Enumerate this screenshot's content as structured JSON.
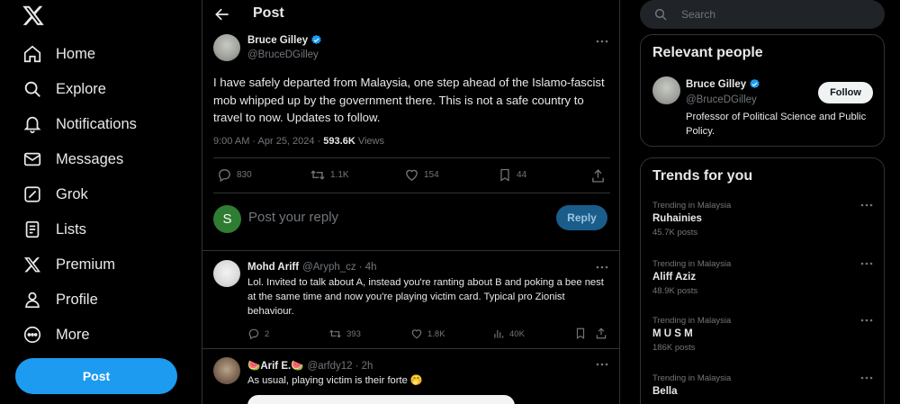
{
  "nav": {
    "items": [
      {
        "label": "Home",
        "icon": "home-icon"
      },
      {
        "label": "Explore",
        "icon": "search-icon"
      },
      {
        "label": "Notifications",
        "icon": "bell-icon"
      },
      {
        "label": "Messages",
        "icon": "envelope-icon"
      },
      {
        "label": "Grok",
        "icon": "grok-icon"
      },
      {
        "label": "Lists",
        "icon": "list-icon"
      },
      {
        "label": "Premium",
        "icon": "x-logo-icon"
      },
      {
        "label": "Profile",
        "icon": "person-icon"
      },
      {
        "label": "More",
        "icon": "more-circle-icon"
      }
    ],
    "post_label": "Post"
  },
  "header": {
    "title": "Post"
  },
  "tweet": {
    "name": "Bruce Gilley",
    "handle": "@BruceDGilley",
    "text": "I have safely departed from Malaysia, one step ahead of the Islamo-fascist mob whipped up by the government there. This is not a safe country to travel to now. Updates to follow.",
    "time": "9:00 AM · Apr 25, 2024 · ",
    "views_count": "593.6K",
    "views_label": " Views",
    "replies": "830",
    "reposts": "1.1K",
    "likes": "154",
    "bookmarks": "44"
  },
  "compose": {
    "avatar_letter": "S",
    "placeholder": "Post your reply",
    "reply_label": "Reply"
  },
  "replies": [
    {
      "name": "Mohd Ariff",
      "handle": "@Aryph_cz",
      "time": "· 4h",
      "text": "Lol. Invited to talk about A, instead you're ranting about B and poking a bee nest at the same time and now you're playing victim card. Typical pro Zionist behaviour.",
      "replies": "2",
      "reposts": "393",
      "likes": "1.8K",
      "views": "40K"
    },
    {
      "name": "🍉Arif E.🍉",
      "handle": "@arfdy12",
      "time": "· 2h",
      "text": "As usual, playing victim is their forte 🤭"
    }
  ],
  "search": {
    "placeholder": "Search"
  },
  "relevant_people": {
    "title": "Relevant people",
    "name": "Bruce Gilley",
    "handle": "@BruceDGilley",
    "bio": "Professor of Political Science and Public Policy.",
    "follow_label": "Follow"
  },
  "trends": {
    "title": "Trends for you",
    "items": [
      {
        "context": "Trending in Malaysia",
        "name": "Ruhainies",
        "count": "45.7K posts"
      },
      {
        "context": "Trending in Malaysia",
        "name": "Aliff Aziz",
        "count": "48.9K posts"
      },
      {
        "context": "Trending in Malaysia",
        "name": "M U S M",
        "count": "186K posts"
      },
      {
        "context": "Trending in Malaysia",
        "name": "Bella",
        "count": ""
      }
    ]
  },
  "colors": {
    "accent": "#1d9bf0",
    "background": "#000000",
    "border": "#2f3336",
    "muted": "#71767b"
  }
}
